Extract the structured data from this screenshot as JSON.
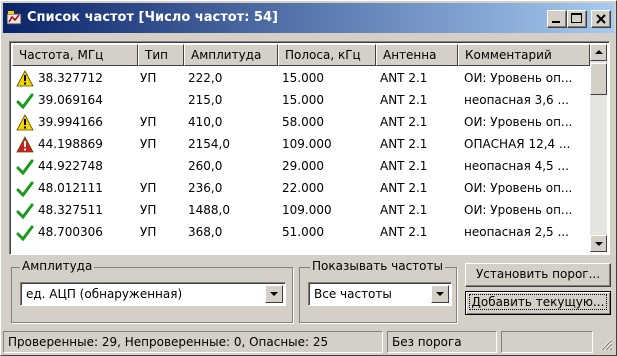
{
  "window": {
    "title": "Список частот [Число частот: 54]"
  },
  "columns": [
    "Частота, МГц",
    "Тип",
    "Амплитуда",
    "Полоса, кГц",
    "Антенна",
    "Комментарий"
  ],
  "rows": [
    {
      "status": "warning",
      "freq": "38.327712",
      "type": "УП",
      "amp": "222,0",
      "band": "15.000",
      "ant": "ANT 2.1",
      "comment": "ОИ: Уровень оп..."
    },
    {
      "status": "ok",
      "freq": "39.069164",
      "type": "",
      "amp": "215,0",
      "band": "15.000",
      "ant": "ANT 2.1",
      "comment": "неопасная  3,6 ..."
    },
    {
      "status": "warning",
      "freq": "39.994166",
      "type": "УП",
      "amp": "410,0",
      "band": "58.000",
      "ant": "ANT 2.1",
      "comment": "ОИ: Уровень оп..."
    },
    {
      "status": "danger",
      "freq": "44.198869",
      "type": "УП",
      "amp": "2154,0",
      "band": "109.000",
      "ant": "ANT 2.1",
      "comment": "ОПАСНАЯ 12,4 ..."
    },
    {
      "status": "ok",
      "freq": "44.922748",
      "type": "",
      "amp": "260,0",
      "band": "29.000",
      "ant": "ANT 2.1",
      "comment": "неопасная  4,5 ..."
    },
    {
      "status": "ok",
      "freq": "48.012111",
      "type": "УП",
      "amp": "236,0",
      "band": "22.000",
      "ant": "ANT 2.1",
      "comment": "ОИ: Уровень оп..."
    },
    {
      "status": "ok",
      "freq": "48.327511",
      "type": "УП",
      "amp": "1488,0",
      "band": "109.000",
      "ant": "ANT 2.1",
      "comment": "ОИ: Уровень оп..."
    },
    {
      "status": "ok",
      "freq": "48.700306",
      "type": "УП",
      "amp": "368,0",
      "band": "51.000",
      "ant": "ANT 2.1",
      "comment": "неопасная  2,5 ..."
    }
  ],
  "amplitude_group": {
    "label": "Амплитуда",
    "selected": "ед. АЦП (обнаруженная)"
  },
  "show_group": {
    "label": "Показывать частоты",
    "selected": "Все частоты"
  },
  "buttons": {
    "set_threshold": "Установить порог...",
    "add_current": "Добавить текущую..."
  },
  "status": {
    "counts": "Проверенные: 29, Непроверенные: 0, Опасные: 25",
    "threshold": "Без порога"
  },
  "colors": {
    "ok": "#1a9a1a",
    "warning": "#f2d600",
    "danger": "#d21e1e"
  }
}
